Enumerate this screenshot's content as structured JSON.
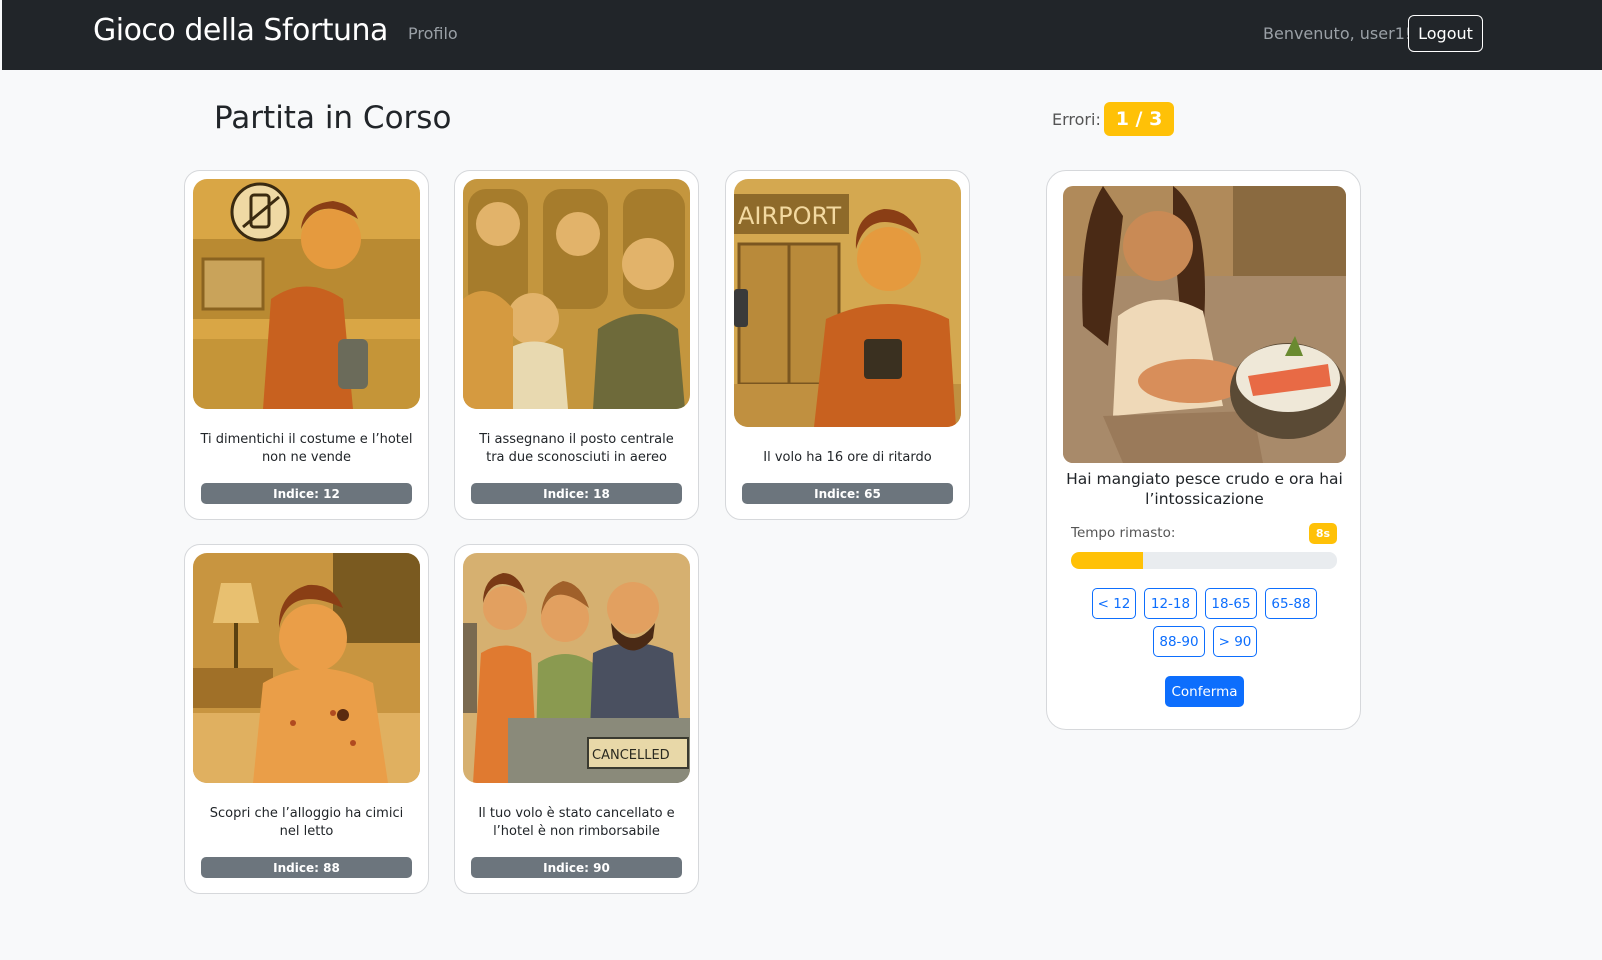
{
  "navbar": {
    "brand": "Gioco della Sfortuna",
    "profile_link": "Profilo",
    "welcome": "Benvenuto, user1!",
    "logout_label": "Logout"
  },
  "game": {
    "title": "Partita in Corso",
    "errors_label": "Errori:",
    "errors_value": "1 / 3"
  },
  "hand": [
    {
      "text": "Ti dimentichi il costume e l’hotel non ne vende",
      "badge": "Indice: 12",
      "illustration": "beach-forgot-swimsuit"
    },
    {
      "text": "Ti assegnano il posto centrale tra due sconosciuti in aereo",
      "badge": "Indice: 18",
      "illustration": "middle-seat-airplane"
    },
    {
      "text": "Il volo ha 16 ore di ritardo",
      "badge": "Indice: 65",
      "illustration": "airport-delay"
    },
    {
      "text": "Scopri che l’alloggio ha cimici nel letto",
      "badge": "Indice: 88",
      "illustration": "bed-bugs"
    },
    {
      "text": "Il tuo volo è stato cancellato e l’hotel è non rimborsabile",
      "badge": "Indice: 90",
      "illustration": "flight-cancelled",
      "sign_text": "CANCELLED"
    }
  ],
  "current": {
    "title": "Hai mangiato pesce crudo e ora hai l’intossicazione",
    "illustration": "food-poisoning",
    "timer_label": "Tempo rimasto:",
    "timer_value": "8s",
    "timer_progress_percent": 27,
    "ranges": [
      "< 12",
      "12-18",
      "18-65",
      "65-88",
      "88-90",
      "> 90"
    ],
    "confirm_label": "Conferma"
  },
  "image_texts": {
    "airport_sign": "AIRPORT",
    "cancelled_sign": "CANCELLED"
  },
  "colors": {
    "navbar_bg": "#212529",
    "warning": "#ffc107",
    "secondary": "#6c757d",
    "primary": "#0d6efd"
  }
}
